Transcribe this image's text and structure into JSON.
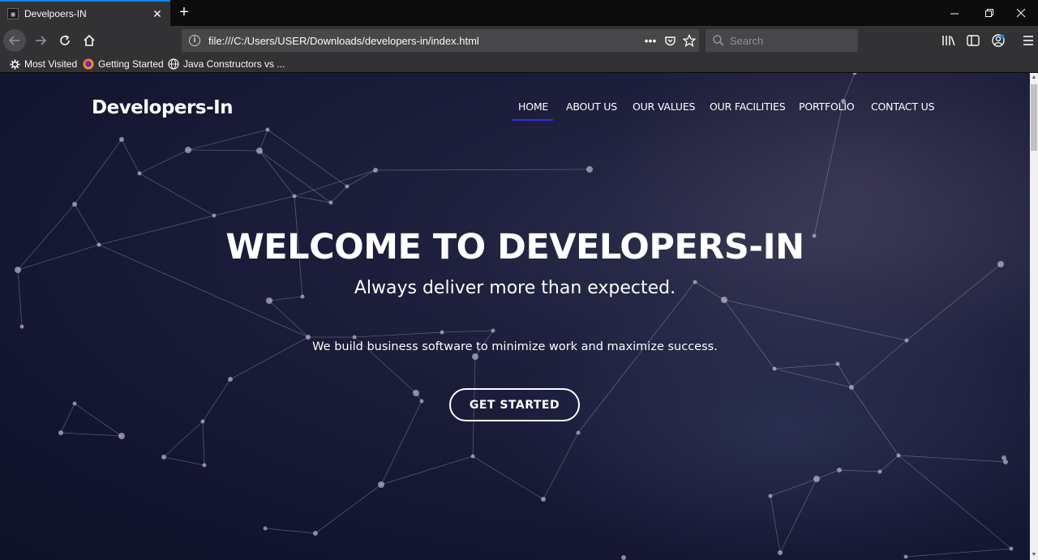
{
  "browser": {
    "tab": {
      "title": "Develpoers-IN",
      "favicon": "page-icon"
    },
    "address": {
      "url": "file:///C:/Users/USER/Downloads/developers-in/index.html"
    },
    "search": {
      "placeholder": "Search"
    },
    "bookmarks": [
      {
        "label": "Most Visited",
        "icon": "gear-icon"
      },
      {
        "label": "Getting Started",
        "icon": "firefox-icon"
      },
      {
        "label": "Java Constructors vs ...",
        "icon": "globe-icon"
      }
    ]
  },
  "site": {
    "brand": "Developers-In",
    "menu": [
      {
        "label": "HOME",
        "active": true
      },
      {
        "label": "ABOUT US"
      },
      {
        "label": "OUR VALUES"
      },
      {
        "label": "OUR FACILITIES"
      },
      {
        "label": "PORTFOLIO"
      },
      {
        "label": "CONTACT US"
      }
    ],
    "hero": {
      "title": "WELCOME TO DEVELOPERS-IN",
      "subtitle": "Always deliver more than expected.",
      "text": "We build business software to minimize work and maximize success.",
      "cta": "GET STARTED"
    },
    "colors": {
      "accent_underline": "#2b2ff0",
      "background": "#141632"
    }
  }
}
